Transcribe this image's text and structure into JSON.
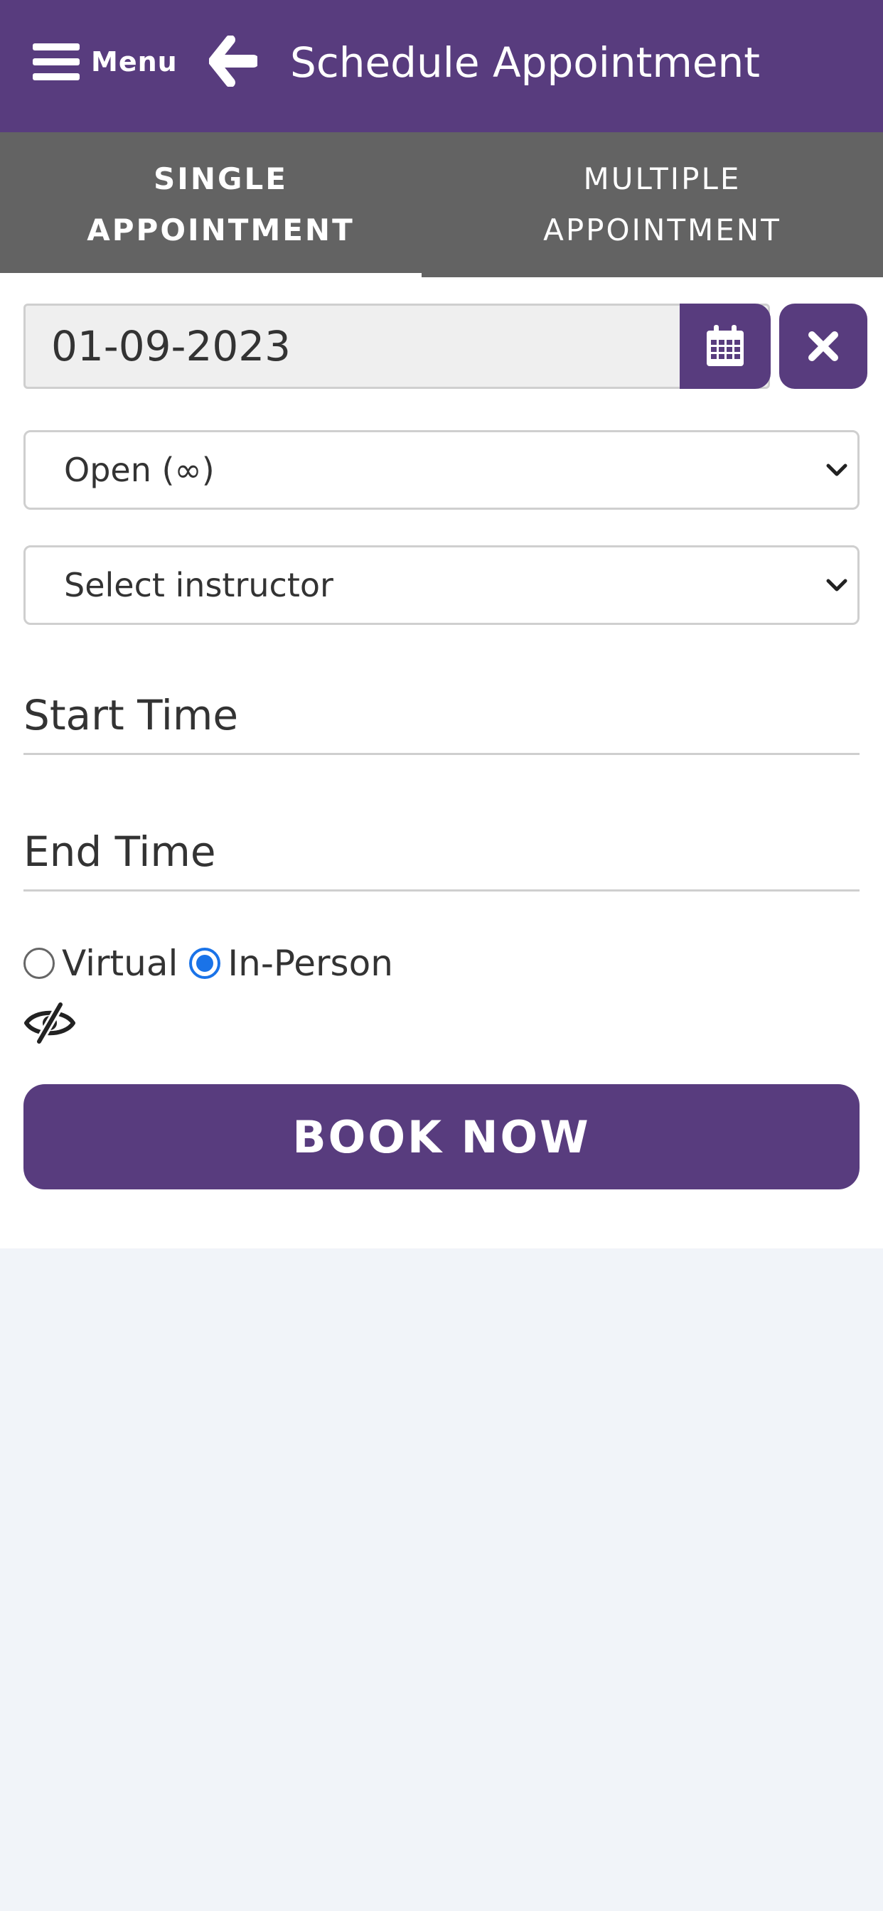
{
  "header": {
    "menu_label": "Menu",
    "title": "Schedule Appointment",
    "icons": {
      "menu": "hamburger-icon",
      "back": "arrow-left-icon"
    }
  },
  "tabs": [
    {
      "line1": "SINGLE",
      "line2": "APPOINTMENT",
      "active": true
    },
    {
      "line1": "MULTIPLE",
      "line2": "APPOINTMENT",
      "active": false
    }
  ],
  "form": {
    "date_value": "01-09-2023",
    "calendar_icon": "calendar-icon",
    "clear_icon": "close-icon",
    "status_select": {
      "value": "Open (∞)"
    },
    "instructor_select": {
      "value": "Select instructor"
    },
    "start_time_placeholder": "Start Time",
    "end_time_placeholder": "End Time",
    "mode_options": [
      {
        "label": "Virtual",
        "checked": false
      },
      {
        "label": "In-Person",
        "checked": true
      }
    ],
    "visibility_icon": "eye-slash-icon",
    "book_label": "BOOK NOW"
  },
  "colors": {
    "brand_purple": "#583c7e",
    "tab_bar_gray": "#636363",
    "page_background": "#f1f4f9",
    "radio_selected": "#1a73e8"
  }
}
